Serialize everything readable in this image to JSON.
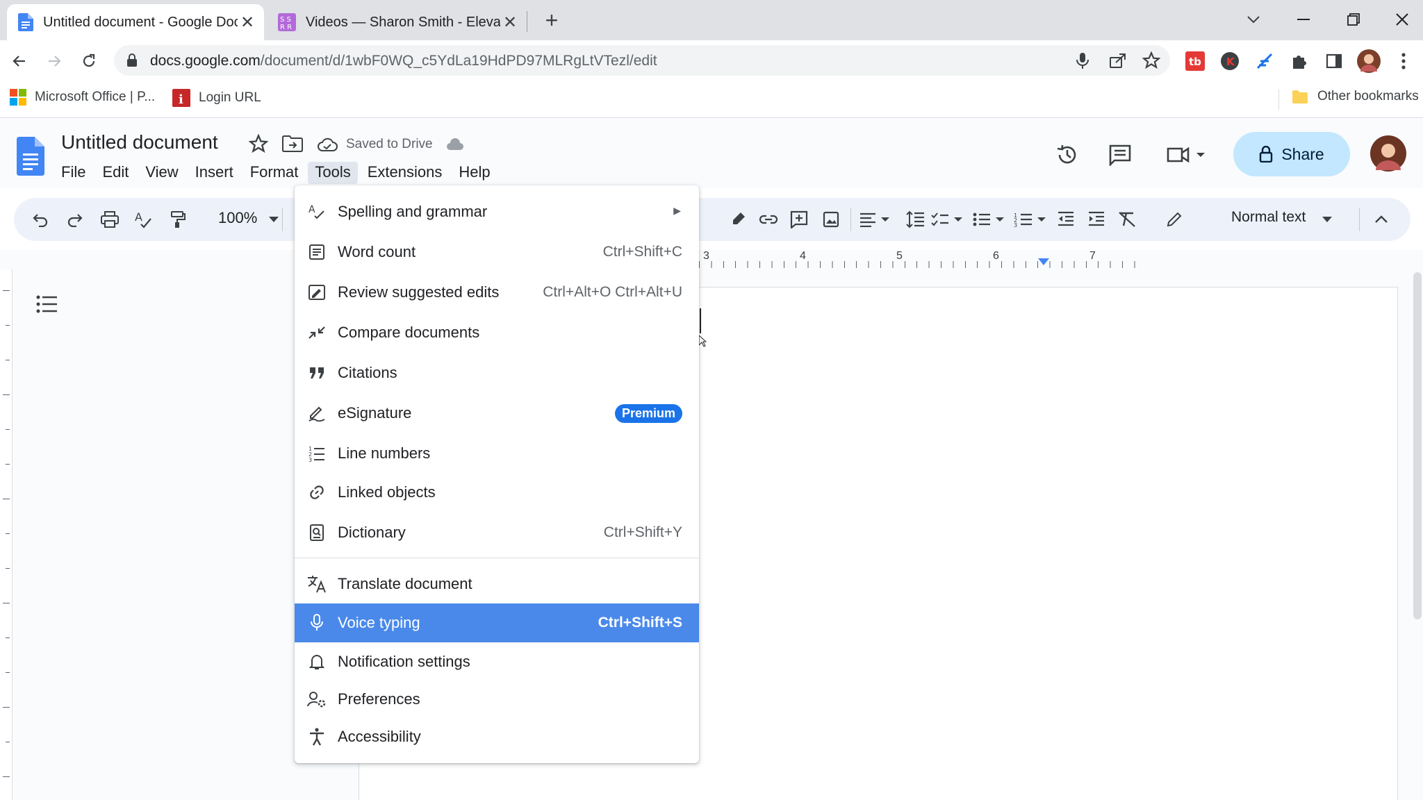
{
  "browser": {
    "tabs": [
      {
        "title": "Untitled document - Google Doc",
        "active": true
      },
      {
        "title": "Videos — Sharon Smith - Elevatir",
        "active": false
      }
    ],
    "url_domain": "docs.google.com",
    "url_path": "/document/d/1wbF0WQ_c5YdLa19HdPD97MLRgLtVTezl/edit",
    "bookmarks": [
      "Microsoft Office | P...",
      "Login URL"
    ],
    "other_bookmarks": "Other bookmarks"
  },
  "doc": {
    "title": "Untitled document",
    "saved_status": "Saved to Drive",
    "menus": [
      "File",
      "Edit",
      "View",
      "Insert",
      "Format",
      "Tools",
      "Extensions",
      "Help"
    ],
    "share_label": "Share",
    "zoom": "100%",
    "paragraph_style": "Normal text",
    "ruler_numbers": [
      "3",
      "4",
      "5",
      "6",
      "7"
    ]
  },
  "tools_menu": {
    "items": [
      {
        "label": "Spelling and grammar",
        "shortcut": "",
        "submenu": true,
        "icon": "spellcheck-icon"
      },
      {
        "label": "Word count",
        "shortcut": "Ctrl+Shift+C",
        "icon": "word-count-icon"
      },
      {
        "label": "Review suggested edits",
        "shortcut": "Ctrl+Alt+O Ctrl+Alt+U",
        "icon": "review-edits-icon"
      },
      {
        "label": "Compare documents",
        "shortcut": "",
        "icon": "compare-icon"
      },
      {
        "label": "Citations",
        "shortcut": "",
        "icon": "quote-icon"
      },
      {
        "label": "eSignature",
        "badge": "Premium",
        "icon": "signature-icon"
      },
      {
        "label": "Line numbers",
        "shortcut": "",
        "icon": "line-numbers-icon"
      },
      {
        "label": "Linked objects",
        "shortcut": "",
        "icon": "link-icon"
      },
      {
        "label": "Dictionary",
        "shortcut": "Ctrl+Shift+Y",
        "icon": "dictionary-icon"
      },
      {
        "label": "Translate document",
        "shortcut": "",
        "icon": "translate-icon"
      },
      {
        "label": "Voice typing",
        "shortcut": "Ctrl+Shift+S",
        "highlighted": true,
        "icon": "mic-icon"
      },
      {
        "label": "Notification settings",
        "shortcut": "",
        "icon": "bell-icon"
      },
      {
        "label": "Preferences",
        "shortcut": "",
        "icon": "preferences-icon"
      },
      {
        "label": "Accessibility",
        "shortcut": "",
        "icon": "accessibility-icon"
      }
    ]
  },
  "colors": {
    "highlight": "#4a89ea",
    "share_bg": "#c2e7ff",
    "docs_blue": "#4285f4",
    "premium_badge": "#1a73e8"
  }
}
